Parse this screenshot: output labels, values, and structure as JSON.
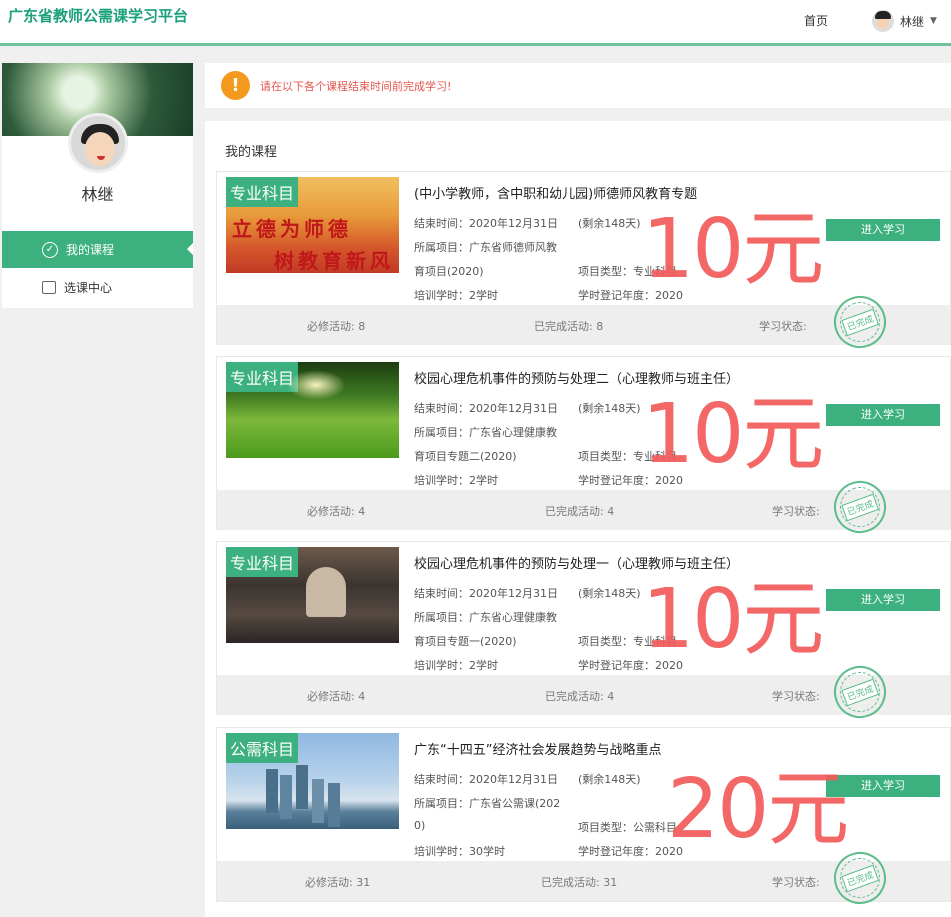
{
  "header": {
    "brand": "广东省教师公需课学习平台",
    "home": "首页",
    "user": "林继"
  },
  "sidebar": {
    "name": "林继",
    "items": [
      {
        "label": "我的课程",
        "active": true
      },
      {
        "label": "选课中心",
        "active": false
      }
    ]
  },
  "notice": {
    "text": "请在以下各个课程结束时间前完成学习!"
  },
  "main": {
    "title": "我的课程",
    "enter_label": "进入学习",
    "stamp_text": "已完成",
    "courses": [
      {
        "tag": "专业科目",
        "image_text": [
          "立德为师德",
          "树教育新风"
        ],
        "title": "(中小学教师，含中职和幼儿园)师德师风教育专题",
        "end_time": "结束时间：2020年12月31日",
        "remaining": "(剩余148天)",
        "project_line1": "所属项目：广东省师德师风教",
        "project_line2": "育项目(2020)",
        "type": "项目类型：专业科目",
        "hours": "培训学时：2学时",
        "year": "学时登记年度：2020",
        "required": "必修活动: 8",
        "completed": "已完成活动: 8",
        "status": "学习状态:",
        "price": "10元"
      },
      {
        "tag": "专业科目",
        "title": "校园心理危机事件的预防与处理二（心理教师与班主任）",
        "end_time": "结束时间：2020年12月31日",
        "remaining": "(剩余148天)",
        "project_line1": "所属项目：广东省心理健康教",
        "project_line2": "育项目专题二(2020)",
        "type": "项目类型：专业科目",
        "hours": "培训学时：2学时",
        "year": "学时登记年度：2020",
        "required": "必修活动: 4",
        "completed": "已完成活动: 4",
        "status": "学习状态:",
        "price": "10元"
      },
      {
        "tag": "专业科目",
        "title": "校园心理危机事件的预防与处理一（心理教师与班主任）",
        "end_time": "结束时间：2020年12月31日",
        "remaining": "(剩余148天)",
        "project_line1": "所属项目：广东省心理健康教",
        "project_line2": "育项目专题一(2020)",
        "type": "项目类型：专业科目",
        "hours": "培训学时：2学时",
        "year": "学时登记年度：2020",
        "required": "必修活动: 4",
        "completed": "已完成活动: 4",
        "status": "学习状态:",
        "price": "10元"
      },
      {
        "tag": "公需科目",
        "title": "广东“十四五”经济社会发展趋势与战略重点",
        "end_time": "结束时间：2020年12月31日",
        "remaining": "(剩余148天)",
        "project_line1": "所属项目：广东省公需课(202",
        "project_line2": "0)",
        "type": "项目类型：公需科目",
        "hours": "培训学时：30学时",
        "year": "学时登记年度：2020",
        "required": "必修活动: 31",
        "completed": "已完成活动: 31",
        "status": "学习状态:",
        "price": "20元"
      }
    ]
  },
  "colors": {
    "accent": "#3cb17f",
    "warning": "#f39a1e",
    "price": "#f25b5b"
  }
}
